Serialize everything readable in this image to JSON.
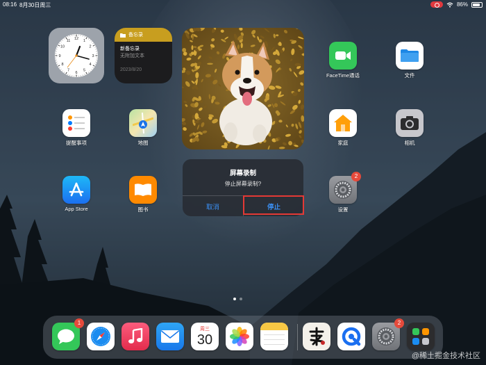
{
  "status_bar": {
    "time": "08:16",
    "date": "8月30日周三",
    "battery_percent": "86%",
    "battery_level": 0.86
  },
  "widgets": {
    "notes": {
      "title": "备忘录",
      "note_title": "新备忘录",
      "note_subtitle": "无附加文本",
      "note_date": "2023/8/20"
    }
  },
  "apps": {
    "facetime": "FaceTime通话",
    "files": "文件",
    "reminders": "提醒事项",
    "maps": "地图",
    "home": "家庭",
    "camera": "相机",
    "appstore": "App Store",
    "books": "图书",
    "settings": "设置",
    "settings_badge": "2"
  },
  "alert": {
    "title": "屏幕录制",
    "message": "停止屏幕录制?",
    "cancel_label": "取消",
    "stop_label": "停止"
  },
  "dock": {
    "messages_badge": "1",
    "calendar_weekday": "周三",
    "calendar_day": "30",
    "settings_badge": "2"
  },
  "watermark": "@稀土掘金技术社区"
}
